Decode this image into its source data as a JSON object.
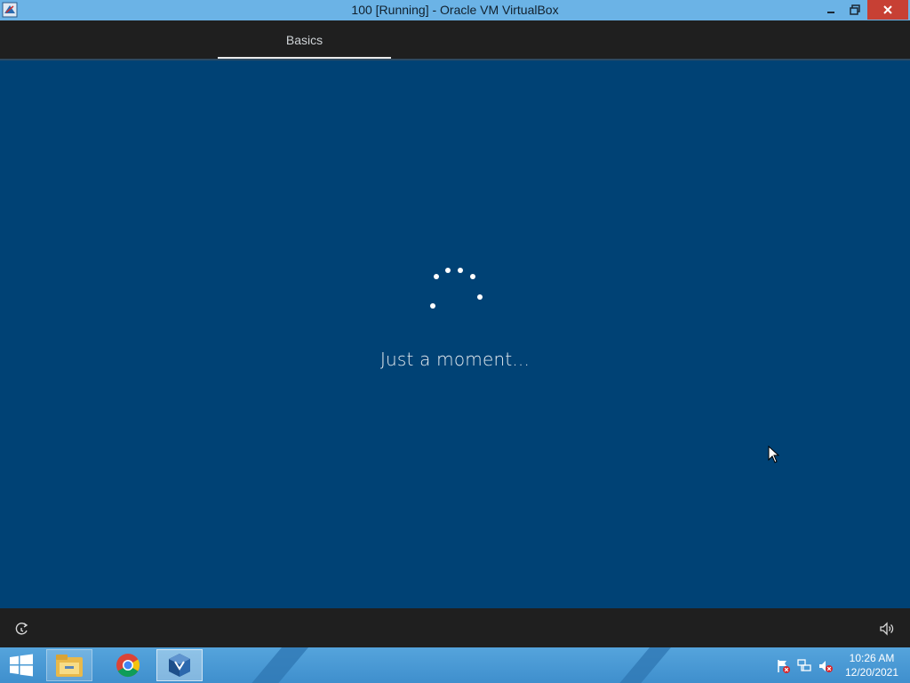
{
  "window": {
    "title": "100 [Running] - Oracle VM VirtualBox",
    "minimize_symbol": "–",
    "restore_symbol": "❐",
    "close_symbol": "✕",
    "close_color": "#c74034"
  },
  "oobe": {
    "tabs": [
      {
        "label": "Basics",
        "selected": true
      }
    ],
    "status_text": "Just a moment...",
    "background_color": "#004275",
    "bar_color": "#1f1f1f"
  },
  "footer": {
    "left_icon": "ease-of-access-icon",
    "right_icon": "volume-icon"
  },
  "taskbar": {
    "apps": [
      "file-explorer-icon",
      "chrome-icon",
      "virtualbox-icon"
    ],
    "active_app": "virtualbox-icon",
    "tray_icons": [
      "action-center-flag-icon",
      "network-icon",
      "speaker-muted-icon"
    ],
    "clock": {
      "time": "10:26 AM",
      "date": "12/20/2021"
    }
  }
}
